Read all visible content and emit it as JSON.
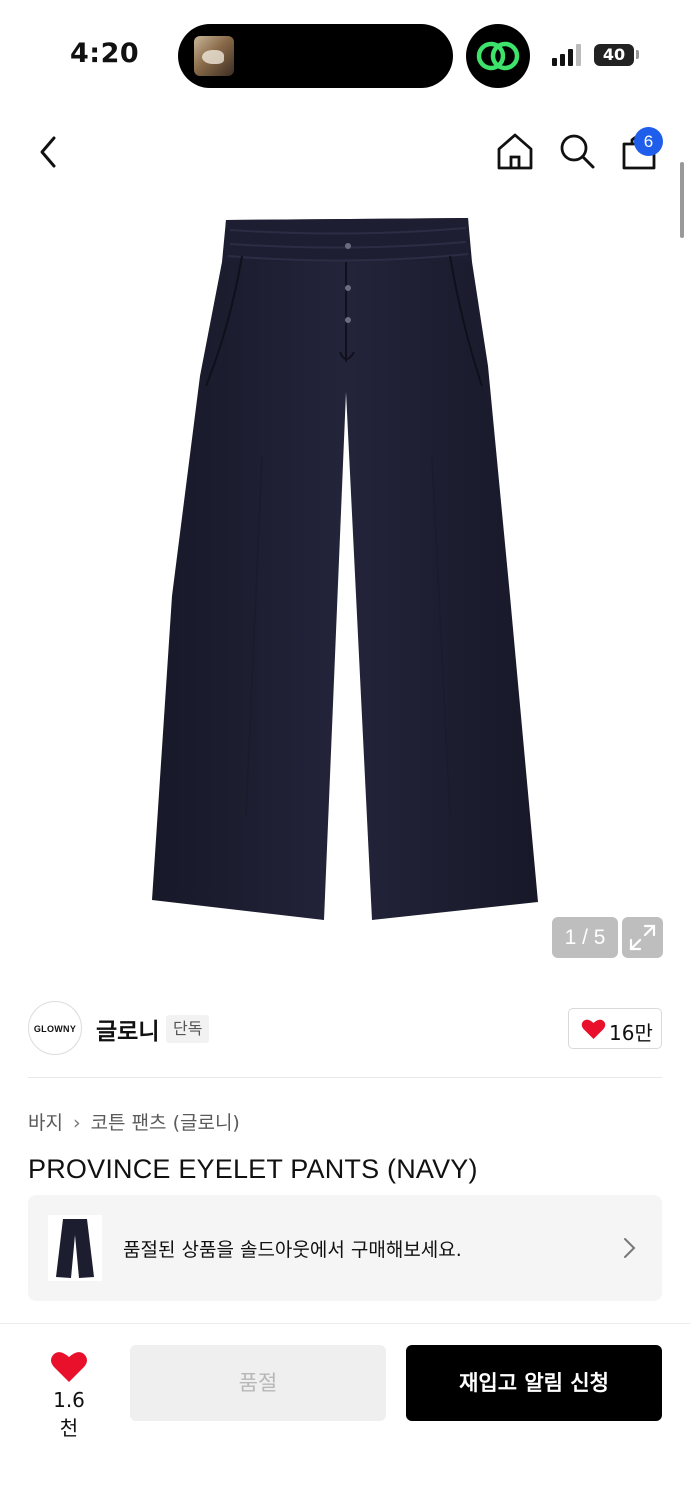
{
  "status_bar": {
    "time": "4:20",
    "battery": "40"
  },
  "header": {
    "cart_badge": "6"
  },
  "gallery": {
    "counter": "1 / 5"
  },
  "brand": {
    "logo_text": "GLOWNY",
    "name": "글로니",
    "tag": "단독",
    "like_count": "16만"
  },
  "product": {
    "breadcrumb": [
      "바지",
      "코튼 팬츠 (글로니)"
    ],
    "title": "PROVINCE EYELET PANTS (NAVY)"
  },
  "soldout_card": {
    "text": "품절된 상품을 솔드아웃에서 구매해보세요."
  },
  "bottom_bar": {
    "favorite_count": "1.6천",
    "soldout_label": "품절",
    "restock_label": "재입고 알림 신청"
  },
  "colors": {
    "accent_badge": "#1e5eea",
    "heart": "#e8102a",
    "pants": "#1c1d2e"
  },
  "icons": [
    "back-arrow-icon",
    "home-icon",
    "search-icon",
    "cart-icon",
    "expand-icon",
    "heart-icon",
    "chevron-right-icon",
    "signal-icon",
    "battery-icon"
  ]
}
